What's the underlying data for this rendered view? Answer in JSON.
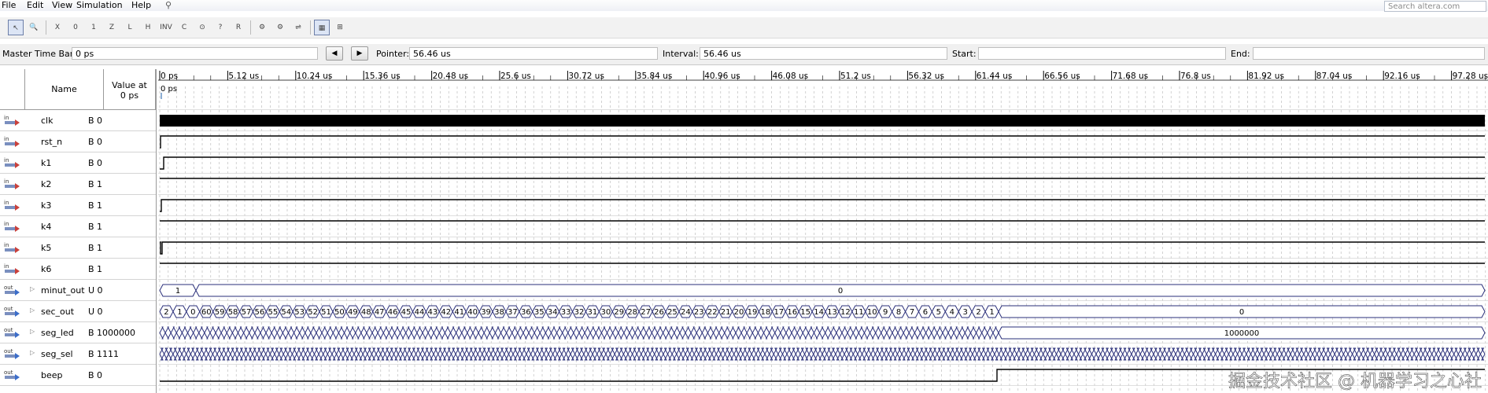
{
  "menu": {
    "file": "File",
    "edit": "Edit",
    "view": "View",
    "simulation": "Simulation",
    "help": "Help",
    "search_placeholder": "Search altera.com"
  },
  "toolbar": {
    "tools": [
      "pointer-tool",
      "zoom-tool",
      "uninit-tool",
      "force-low-tool",
      "force-high-tool",
      "force-high-z-tool",
      "force-weak-low-tool",
      "force-weak-high-tool",
      "invert-tool",
      "count-value-tool",
      "clock-tool",
      "random-tool",
      "arbitrary-value-tool",
      "snap-tool",
      "grid-tool"
    ]
  },
  "timebar": {
    "master_label": "Master Time Bar:",
    "master_value": "0 ps",
    "pointer_label": "Pointer:",
    "pointer_value": "56.46 us",
    "interval_label": "Interval:",
    "interval_value": "56.46 us",
    "start_label": "Start:",
    "start_value": "",
    "end_label": "End:",
    "end_value": ""
  },
  "header": {
    "name": "Name",
    "value_at": "Value at",
    "value_time": "0 ps",
    "origin": "0 ps"
  },
  "ruler": {
    "ticks": [
      "0 ps",
      "5.12 us",
      "10.24 us",
      "15.36 us",
      "20.48 us",
      "25.6 us",
      "30.72 us",
      "35.84 us",
      "40.96 us",
      "46.08 us",
      "51.2 us",
      "56.32 us",
      "61.44 us",
      "66.56 us",
      "71.68 us",
      "76.8 us",
      "81.92 us",
      "87.04 us",
      "92.16 us",
      "97.28 us"
    ]
  },
  "signals": [
    {
      "dir": "in",
      "name": "clk",
      "value": "B 0",
      "bus": false
    },
    {
      "dir": "in",
      "name": "rst_n",
      "value": "B 0",
      "bus": false
    },
    {
      "dir": "in",
      "name": "k1",
      "value": "B 0",
      "bus": false
    },
    {
      "dir": "in",
      "name": "k2",
      "value": "B 1",
      "bus": false
    },
    {
      "dir": "in",
      "name": "k3",
      "value": "B 1",
      "bus": false
    },
    {
      "dir": "in",
      "name": "k4",
      "value": "B 1",
      "bus": false
    },
    {
      "dir": "in",
      "name": "k5",
      "value": "B 1",
      "bus": false
    },
    {
      "dir": "in",
      "name": "k6",
      "value": "B 1",
      "bus": false
    },
    {
      "dir": "out",
      "name": "minut_out",
      "value": "U 0",
      "bus": true
    },
    {
      "dir": "out",
      "name": "sec_out",
      "value": "U 0",
      "bus": true
    },
    {
      "dir": "out",
      "name": "seg_led",
      "value": "B 1000000",
      "bus": true
    },
    {
      "dir": "out",
      "name": "seg_sel",
      "value": "B 1111",
      "bus": true
    },
    {
      "dir": "out",
      "name": "beep",
      "value": "B 0",
      "bus": false
    }
  ],
  "waves": {
    "minut_labels": [
      "1",
      "0"
    ],
    "sec_count_labels": [
      "2",
      "1",
      "0",
      "60",
      "59",
      "58",
      "57",
      "56",
      "55",
      "54",
      "53",
      "52",
      "51",
      "50",
      "49",
      "48",
      "47",
      "46",
      "45",
      "44",
      "43",
      "42",
      "41",
      "40",
      "39",
      "38",
      "37",
      "36",
      "35",
      "34",
      "33",
      "32",
      "31",
      "30",
      "29",
      "28",
      "27",
      "26",
      "25",
      "24",
      "23",
      "22",
      "21",
      "20",
      "19",
      "18",
      "17",
      "16",
      "15",
      "14",
      "13",
      "12",
      "11",
      "10",
      "9",
      "8",
      "7",
      "6",
      "5",
      "4",
      "3",
      "2",
      "1"
    ],
    "sec_tail_label": "0",
    "seg_led_tail_label": "1000000"
  },
  "colors": {
    "waveform": "#000000",
    "bus": "#2a2f7a",
    "grid": "#9a9a9a",
    "row_line": "#d4d4d4"
  },
  "watermark": "掘金技术社区 @ 机器学习之心社"
}
